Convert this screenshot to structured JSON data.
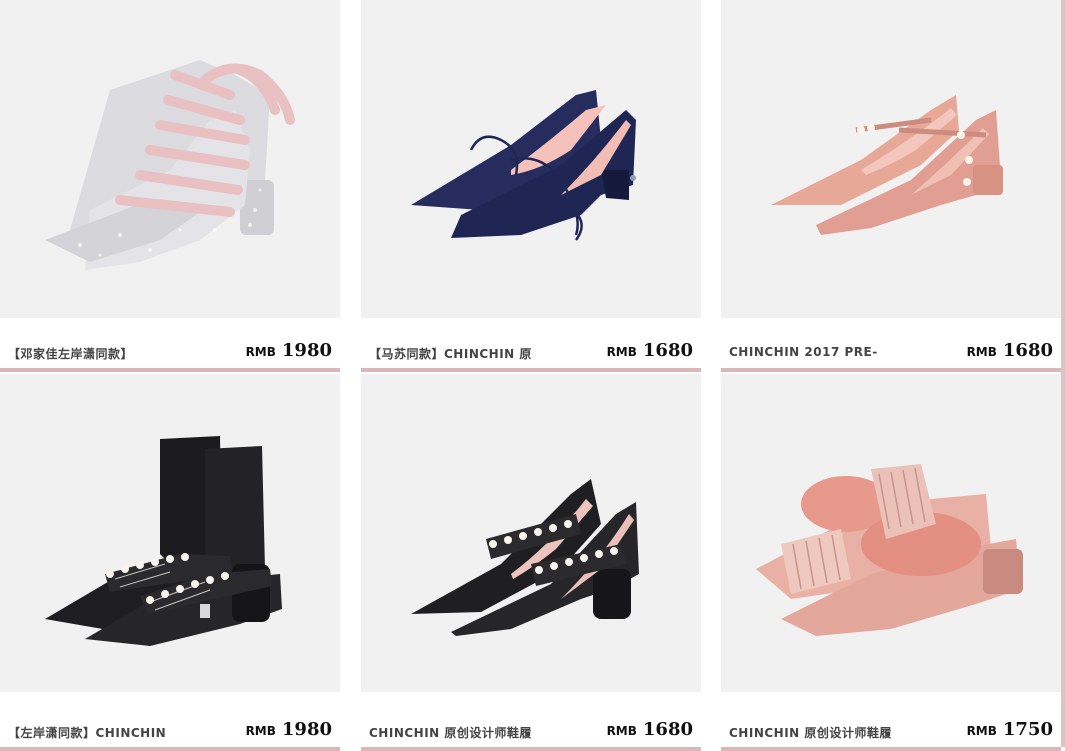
{
  "products": [
    {
      "name": "【邓家佳左岸潇同款】",
      "currency": "RMB",
      "price": "1980"
    },
    {
      "name": "【马苏同款】CHINCHIN 原",
      "currency": "RMB",
      "price": "1680"
    },
    {
      "name": "CHINCHIN 2017 PRE-",
      "currency": "RMB",
      "price": "1680"
    },
    {
      "name": "【左岸潇同款】CHINCHIN",
      "currency": "RMB",
      "price": "1980"
    },
    {
      "name": "CHINCHIN 原创设计师鞋履",
      "currency": "RMB",
      "price": "1680"
    },
    {
      "name": "CHINCHIN 原创设计师鞋履",
      "currency": "RMB",
      "price": "1750"
    }
  ],
  "colors": {
    "image_bg": "#f2f1f1",
    "underline": "#dbb6b6",
    "silver_glitter": "#d9d9dc",
    "ribbon_pink": "#e8bfc0",
    "navy_velvet": "#1f2654",
    "nude_patent": "#e6a79a",
    "black_leather": "#1e1e20",
    "pink_suede": "#e9b1a6"
  }
}
